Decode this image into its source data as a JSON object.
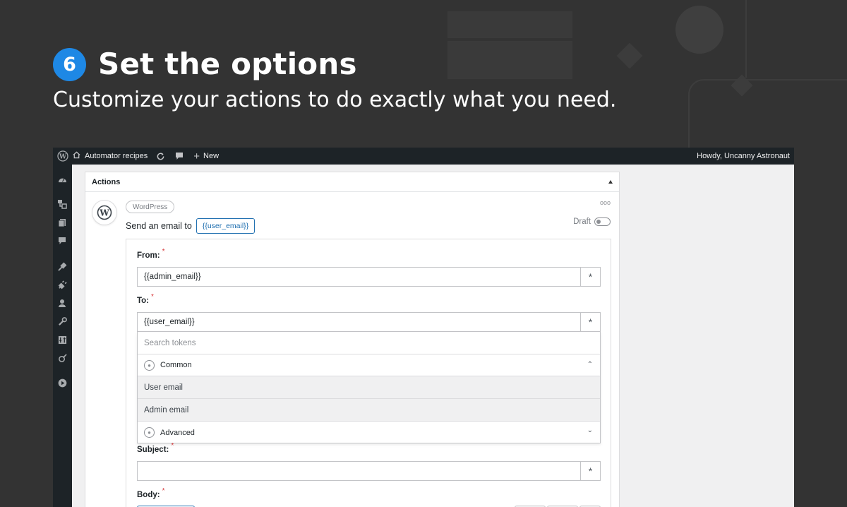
{
  "step": {
    "number": "6",
    "title": "Set the options",
    "subtitle": "Customize your actions to do exactly what you need."
  },
  "adminbar": {
    "site_name": "Automator recipes",
    "new_label": "New",
    "howdy": "Howdy, Uncanny Astronaut"
  },
  "panel": {
    "title": "Actions",
    "integration": "WordPress",
    "sentence": "Send an email to",
    "sentence_token": "{{user_email}}",
    "status": "Draft",
    "more": "ooo"
  },
  "fields": {
    "from": {
      "label": "From:",
      "value": "{{admin_email}}"
    },
    "to": {
      "label": "To:",
      "value": "{{user_email}}"
    },
    "subject": {
      "label": "Subject:",
      "value": ""
    },
    "body": {
      "label": "Body:"
    },
    "required_mark": "*",
    "token_button": "*"
  },
  "token_dropdown": {
    "search_placeholder": "Search tokens",
    "groups": [
      {
        "label": "Common",
        "expanded": true,
        "items": [
          "User email",
          "Admin email"
        ]
      },
      {
        "label": "Advanced",
        "expanded": false,
        "items": []
      }
    ]
  },
  "colors": {
    "background": "#333333",
    "accent": "#1e88e5",
    "wp_link": "#2271b1",
    "required": "#d63638"
  }
}
